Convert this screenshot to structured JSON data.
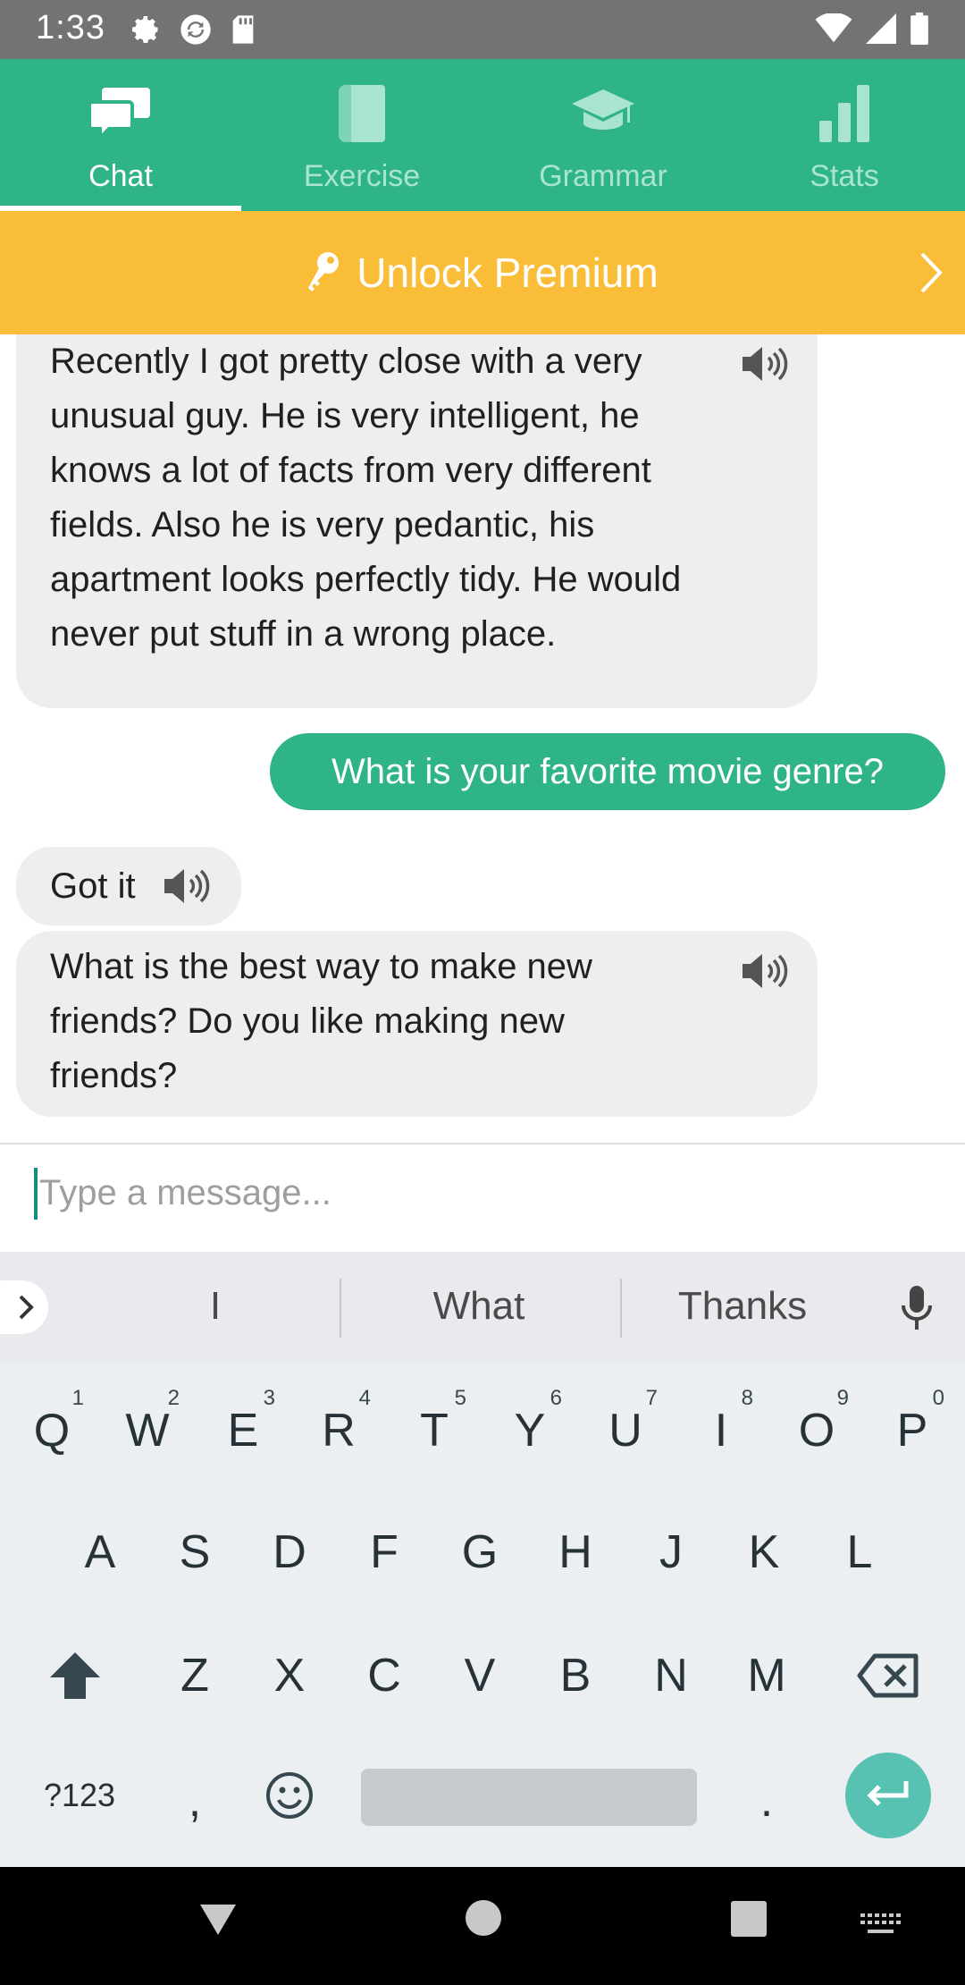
{
  "status_bar": {
    "time": "1:33",
    "left_icons": [
      "settings-icon",
      "sync-icon",
      "sd-card-icon"
    ],
    "right_icons": [
      "wifi-icon",
      "signal-icon",
      "battery-icon"
    ]
  },
  "tabs": [
    {
      "label": "Chat",
      "icon": "chat-icon",
      "active": true
    },
    {
      "label": "Exercise",
      "icon": "book-icon",
      "active": false
    },
    {
      "label": "Grammar",
      "icon": "graduation-cap-icon",
      "active": false
    },
    {
      "label": "Stats",
      "icon": "bar-chart-icon",
      "active": false
    }
  ],
  "premium_banner": {
    "label": "Unlock Premium",
    "icon": "key-icon"
  },
  "messages": [
    {
      "from": "bot",
      "text": "Recently I got pretty close with a very unusual guy. He is very intelligent, he knows a lot of facts from very different fields. Also he is very pedantic, his apartment looks perfectly tidy. He would never put stuff in a wrong place."
    },
    {
      "from": "user",
      "text": "What is your favorite movie genre?"
    },
    {
      "from": "bot",
      "text": "Got it"
    },
    {
      "from": "bot",
      "text": "What is the best way to make new friends? Do you like making new friends?"
    }
  ],
  "composer": {
    "placeholder": "Type a message..."
  },
  "keyboard": {
    "suggestions": [
      "I",
      "What",
      "Thanks"
    ],
    "row1": [
      {
        "k": "Q",
        "n": "1"
      },
      {
        "k": "W",
        "n": "2"
      },
      {
        "k": "E",
        "n": "3"
      },
      {
        "k": "R",
        "n": "4"
      },
      {
        "k": "T",
        "n": "5"
      },
      {
        "k": "Y",
        "n": "6"
      },
      {
        "k": "U",
        "n": "7"
      },
      {
        "k": "I",
        "n": "8"
      },
      {
        "k": "O",
        "n": "9"
      },
      {
        "k": "P",
        "n": "0"
      }
    ],
    "row2": [
      "A",
      "S",
      "D",
      "F",
      "G",
      "H",
      "J",
      "K",
      "L"
    ],
    "row3": [
      "Z",
      "X",
      "C",
      "V",
      "B",
      "N",
      "M"
    ],
    "symbols_label": "?123",
    "comma": ",",
    "period": "."
  },
  "colors": {
    "brand_green": "#2fb487",
    "premium_yellow": "#f9bd38",
    "status_bar": "#737373",
    "bot_bubble": "#eeeeee",
    "enter_key": "#57c2b1"
  }
}
